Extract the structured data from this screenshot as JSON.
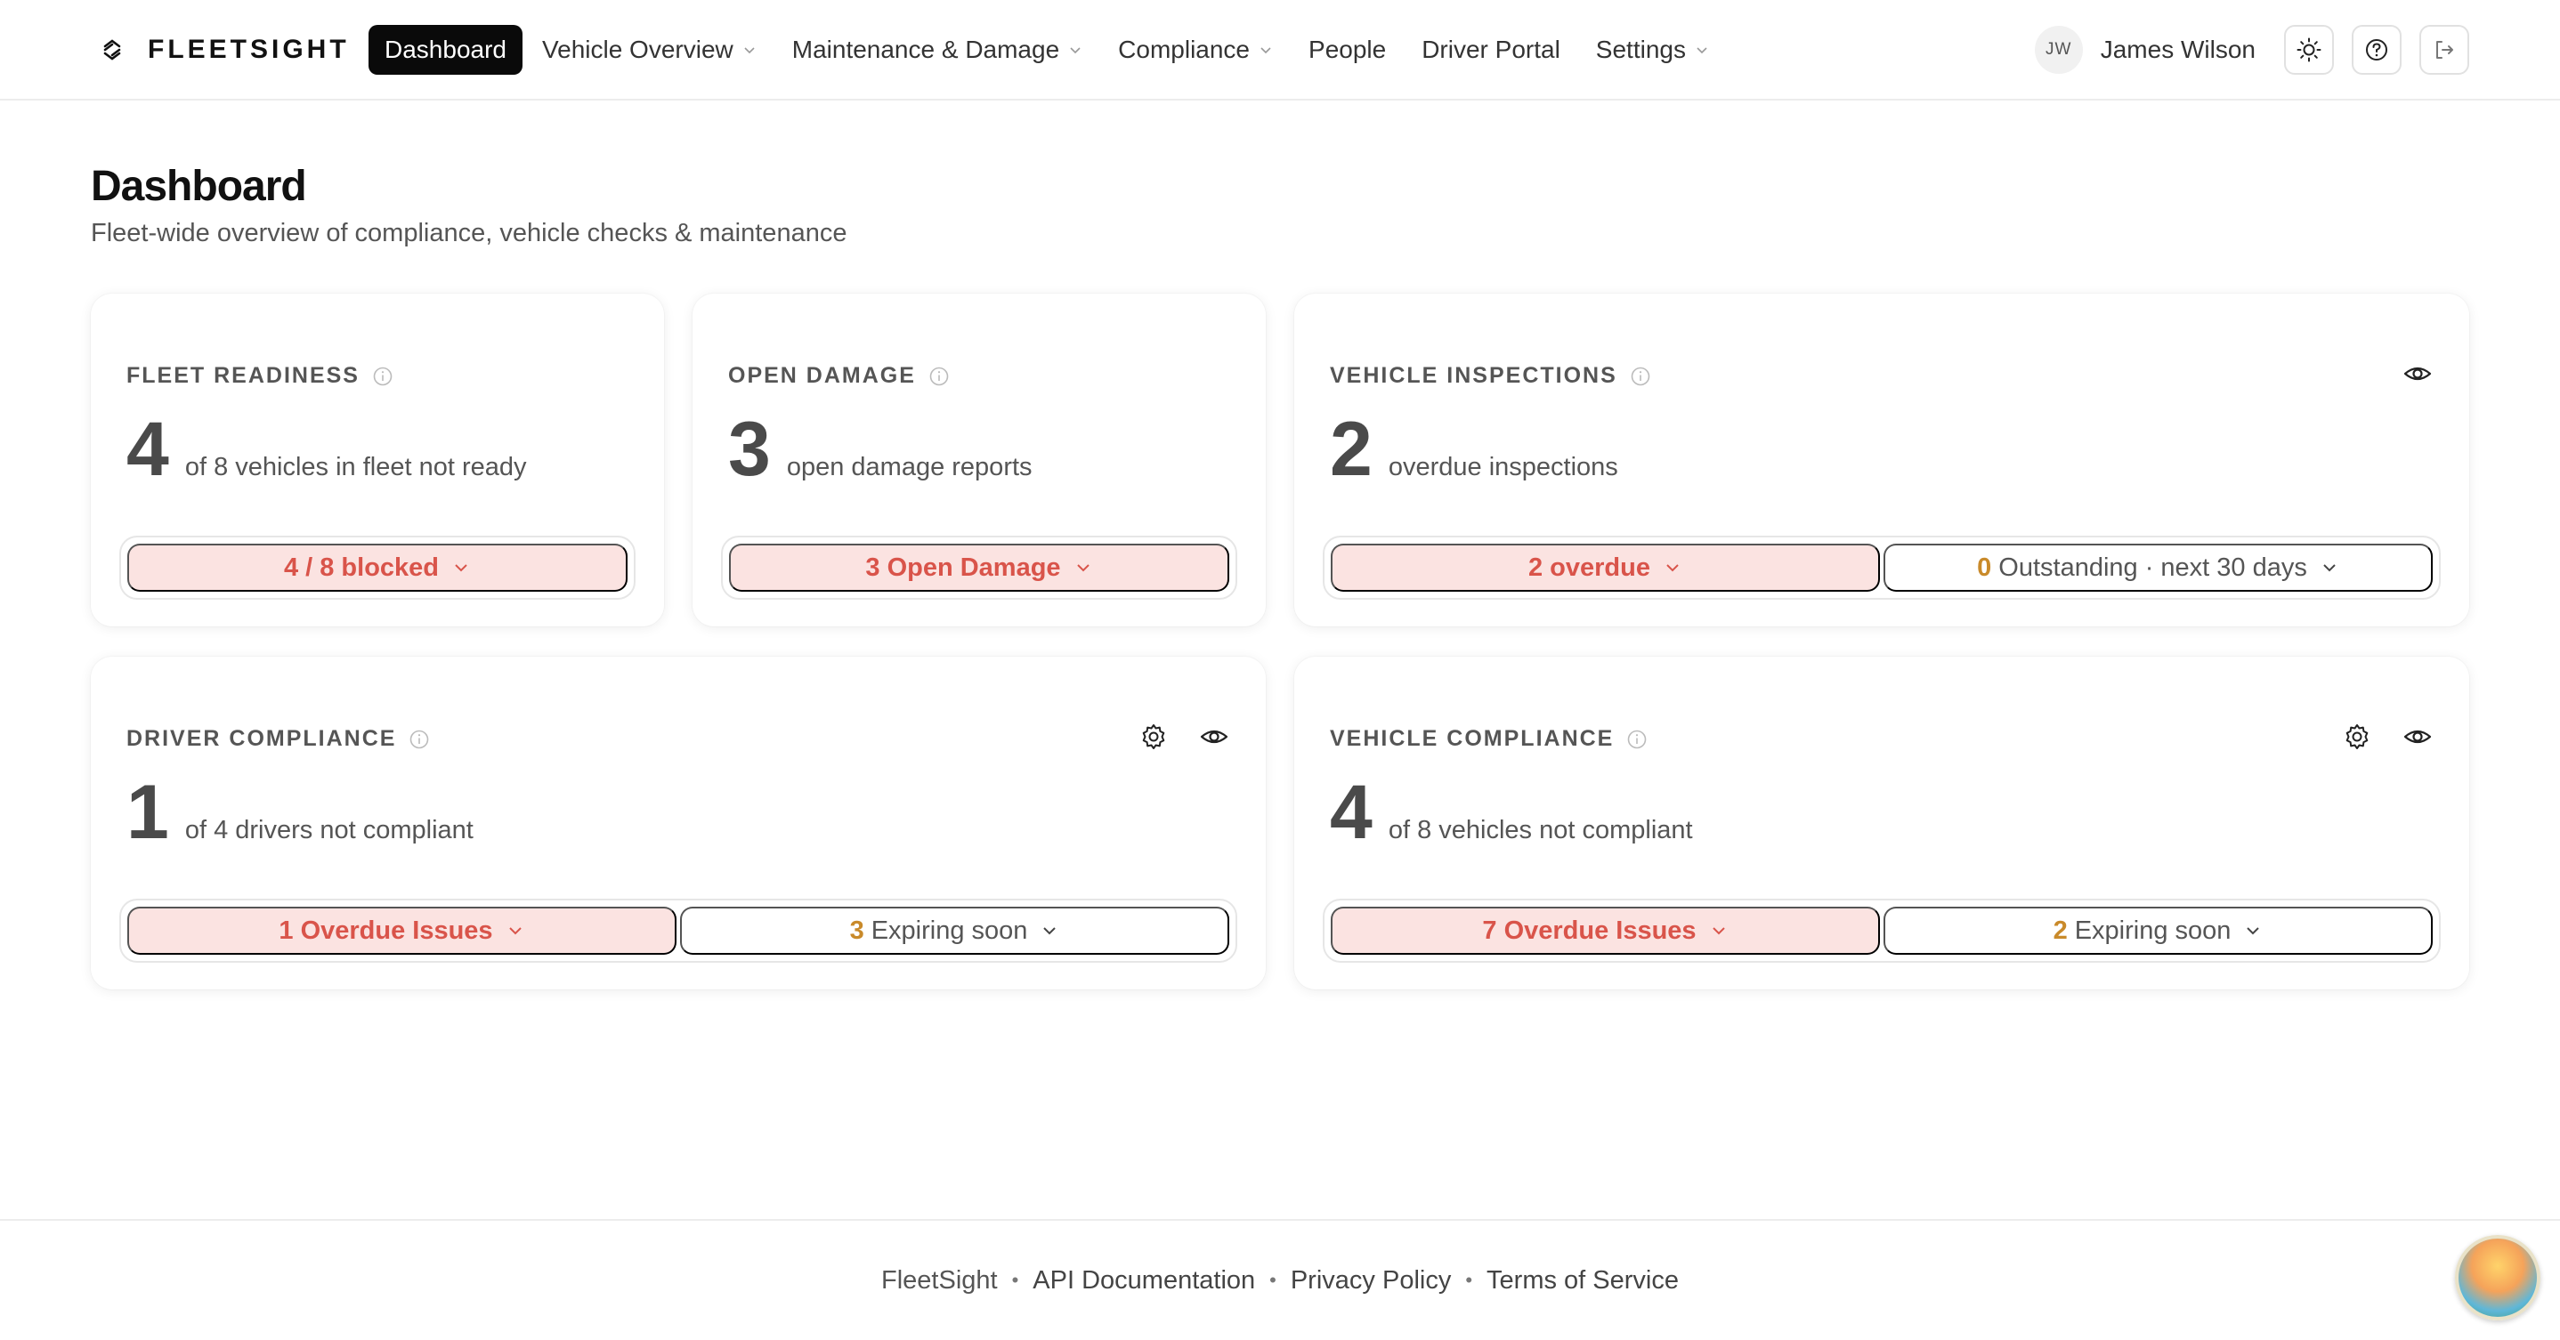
{
  "brand": {
    "name": "FLEETSIGHT"
  },
  "nav": [
    {
      "label": "Dashboard",
      "active": true,
      "dropdown": false
    },
    {
      "label": "Vehicle Overview",
      "dropdown": true
    },
    {
      "label": "Maintenance & Damage",
      "dropdown": true
    },
    {
      "label": "Compliance",
      "dropdown": true
    },
    {
      "label": "People",
      "dropdown": false
    },
    {
      "label": "Driver Portal",
      "dropdown": false
    },
    {
      "label": "Settings",
      "dropdown": true
    }
  ],
  "user": {
    "initials": "JW",
    "name": "James Wilson"
  },
  "page": {
    "title": "Dashboard",
    "subtitle": "Fleet-wide overview of compliance, vehicle checks & maintenance"
  },
  "cards": {
    "fleet_readiness": {
      "label": "FLEET READINESS",
      "value": "4",
      "text": "of 8 vehicles in fleet not ready",
      "pill": {
        "count": "4",
        "label": "/ 8 blocked"
      }
    },
    "open_damage": {
      "label": "OPEN DAMAGE",
      "value": "3",
      "text": "open damage reports",
      "pill": {
        "count": "3",
        "label": "Open Damage"
      }
    },
    "vehicle_inspections": {
      "label": "VEHICLE INSPECTIONS",
      "value": "2",
      "text": "overdue inspections",
      "pill_overdue": {
        "count": "2",
        "label": "overdue"
      },
      "pill_outstanding": {
        "count": "0",
        "label": "Outstanding · next 30 days"
      }
    },
    "driver_compliance": {
      "label": "DRIVER COMPLIANCE",
      "value": "1",
      "text": "of 4 drivers not compliant",
      "pill_overdue": {
        "count": "1",
        "label": "Overdue Issues"
      },
      "pill_expiring": {
        "count": "3",
        "label": "Expiring soon"
      }
    },
    "vehicle_compliance": {
      "label": "VEHICLE COMPLIANCE",
      "value": "4",
      "text": "of 8 vehicles not compliant",
      "pill_overdue": {
        "count": "7",
        "label": "Overdue Issues"
      },
      "pill_expiring": {
        "count": "2",
        "label": "Expiring soon"
      }
    }
  },
  "footer": {
    "brand": "FleetSight",
    "links": [
      "API Documentation",
      "Privacy Policy",
      "Terms of Service"
    ],
    "separator": "•"
  },
  "colors": {
    "accent_red": "#d9544a",
    "pill_red_bg": "#fbe3e1",
    "accent_orange": "#c98a2a",
    "nav_active_bg": "#0a0a0a"
  }
}
